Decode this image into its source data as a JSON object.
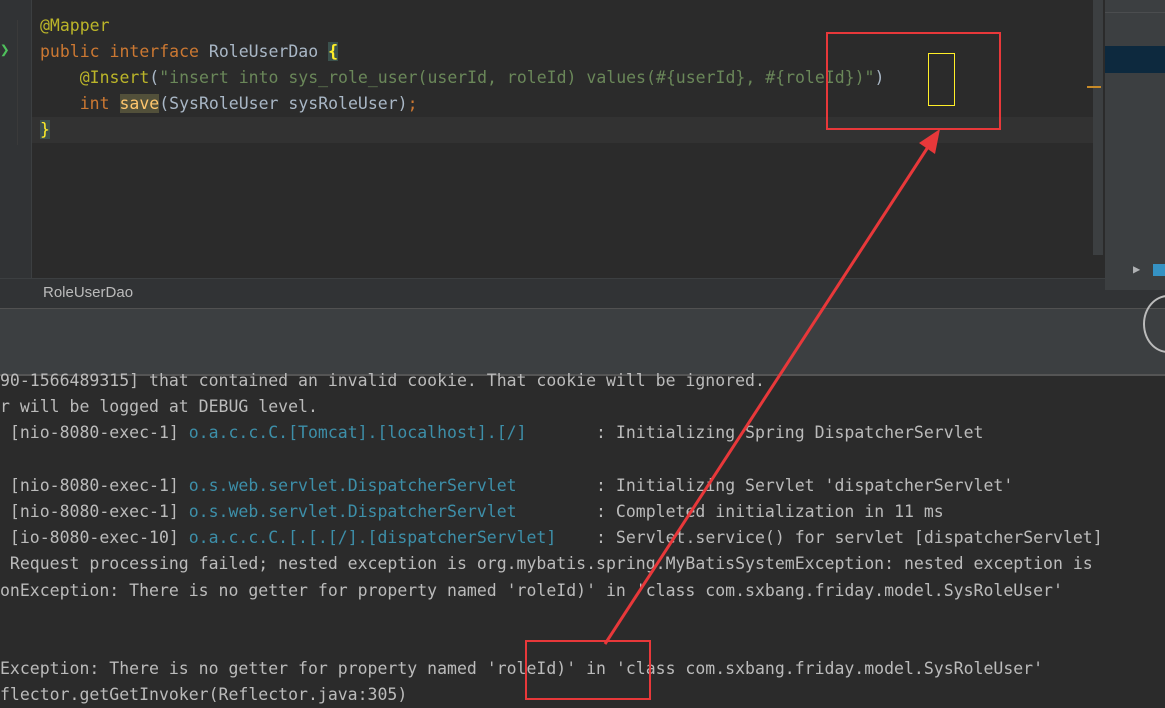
{
  "editor": {
    "lines": [
      {
        "parts": [
          {
            "t": "@Mapper",
            "c": "ann"
          }
        ]
      },
      {
        "parts": [
          {
            "t": "public",
            "c": "kw"
          },
          {
            "t": " "
          },
          {
            "t": "interface",
            "c": "kw"
          },
          {
            "t": " RoleUserDao "
          },
          {
            "t": "{",
            "c": "brace-hl"
          }
        ]
      },
      {
        "parts": [
          {
            "t": "    "
          },
          {
            "t": "@Insert",
            "c": "ann"
          },
          {
            "t": "("
          },
          {
            "t": "\"insert into sys_role_user(userId, roleId) values(#{userId}, #{roleId})\"",
            "c": "str"
          },
          {
            "t": ")"
          }
        ]
      },
      {
        "parts": [
          {
            "t": "    "
          },
          {
            "t": "int",
            "c": "kw"
          },
          {
            "t": " "
          },
          {
            "t": "save",
            "c": "fn save-hl"
          },
          {
            "t": "(SysRoleUser sysRoleUser)"
          },
          {
            "t": ";",
            "c": "kw"
          }
        ]
      },
      {
        "parts": [
          {
            "t": "}",
            "c": "brace-close"
          }
        ]
      }
    ]
  },
  "breadcrumb": {
    "label": "RoleUserDao"
  },
  "console": {
    "lines": [
      {
        "parts": [
          {
            "t": "90-1566489315] that contained an invalid cookie. That cookie will be ignored."
          }
        ]
      },
      {
        "parts": [
          {
            "t": "r will be logged at DEBUG level."
          }
        ]
      },
      {
        "parts": [
          {
            "t": " [nio-8080-exec-1] "
          },
          {
            "t": "o.a.c.c.C.[Tomcat].[localhost].[/]",
            "c": "logger"
          },
          {
            "t": "       : Initializing Spring DispatcherServlet"
          }
        ]
      },
      {
        "parts": [
          {
            "t": ""
          }
        ]
      },
      {
        "parts": [
          {
            "t": " [nio-8080-exec-1] "
          },
          {
            "t": "o.s.web.servlet.DispatcherServlet",
            "c": "logger"
          },
          {
            "t": "        : Initializing Servlet 'dispatcherServlet'"
          }
        ]
      },
      {
        "parts": [
          {
            "t": " [nio-8080-exec-1] "
          },
          {
            "t": "o.s.web.servlet.DispatcherServlet",
            "c": "logger"
          },
          {
            "t": "        : Completed initialization in 11 ms"
          }
        ]
      },
      {
        "parts": [
          {
            "t": " [io-8080-exec-10] "
          },
          {
            "t": "o.a.c.c.C.[.[.[/].[dispatcherServlet]",
            "c": "logger"
          },
          {
            "t": "    : Servlet.service() for servlet [dispatcherServlet]"
          }
        ]
      },
      {
        "parts": [
          {
            "t": " Request processing failed; nested exception is org.mybatis.spring.MyBatisSystemException: nested exception is"
          }
        ]
      },
      {
        "parts": [
          {
            "t": "onException: There is no getter for property named 'roleId)' in 'class com.sxbang.friday.model.SysRoleUser'"
          }
        ]
      },
      {
        "parts": [
          {
            "t": ""
          }
        ]
      },
      {
        "parts": [
          {
            "t": ""
          }
        ]
      },
      {
        "parts": [
          {
            "t": "Exception: There is no getter for property named 'roleId)' in 'class com.sxbang.friday.model.SysRoleUser'"
          }
        ]
      },
      {
        "parts": [
          {
            "t": "flector.getGetInvoker(Reflector.java:305)"
          }
        ]
      }
    ]
  },
  "colors": {
    "highlight_red": "#e8383a",
    "caret_yellow": "#ffef28"
  }
}
